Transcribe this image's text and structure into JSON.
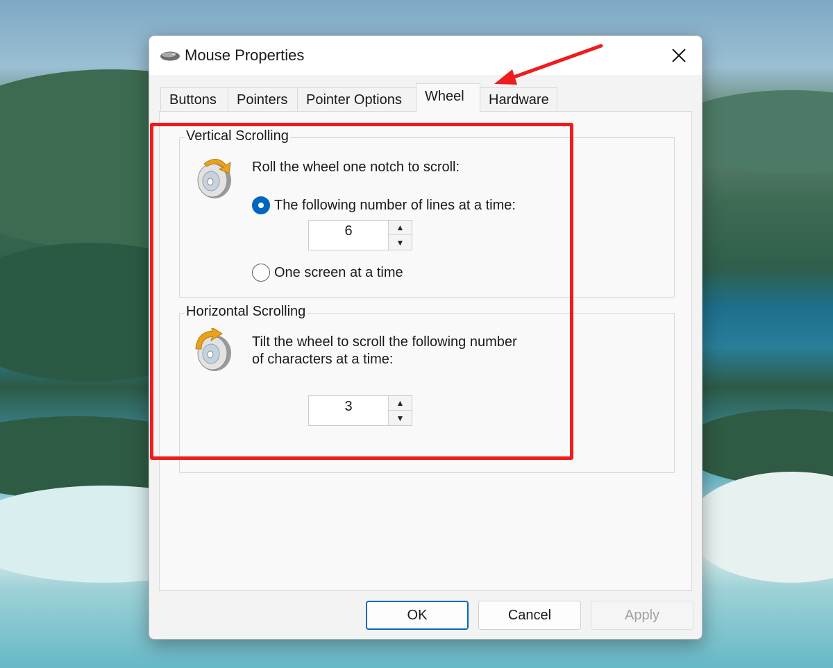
{
  "dialog": {
    "title": "Mouse Properties",
    "close_symbol": "✕"
  },
  "tabs": [
    {
      "label": "Buttons",
      "active": false
    },
    {
      "label": "Pointers",
      "active": false
    },
    {
      "label": "Pointer Options",
      "active": false
    },
    {
      "label": "Wheel",
      "active": true
    },
    {
      "label": "Hardware",
      "active": false
    }
  ],
  "vertical": {
    "title": "Vertical Scrolling",
    "instruction": "Roll the wheel one notch to scroll:",
    "option_lines_label": "The following number of lines at a time:",
    "lines_value": "6",
    "option_screen_label": "One screen at a time",
    "selected_option": "lines"
  },
  "horizontal": {
    "title": "Horizontal Scrolling",
    "instruction_line1": "Tilt the wheel to scroll the following number",
    "instruction_line2": "of characters at a time:",
    "chars_value": "3"
  },
  "buttons": {
    "ok": "OK",
    "cancel": "Cancel",
    "apply": "Apply"
  },
  "icons": {
    "title": "mouse-icon",
    "vertical": "wheel-vertical-icon",
    "horizontal": "wheel-horizontal-icon",
    "close": "close-icon",
    "spin_up": "▲",
    "spin_down": "▼"
  },
  "colors": {
    "accent": "#0067c0",
    "annotation": "#ee1c1c"
  }
}
